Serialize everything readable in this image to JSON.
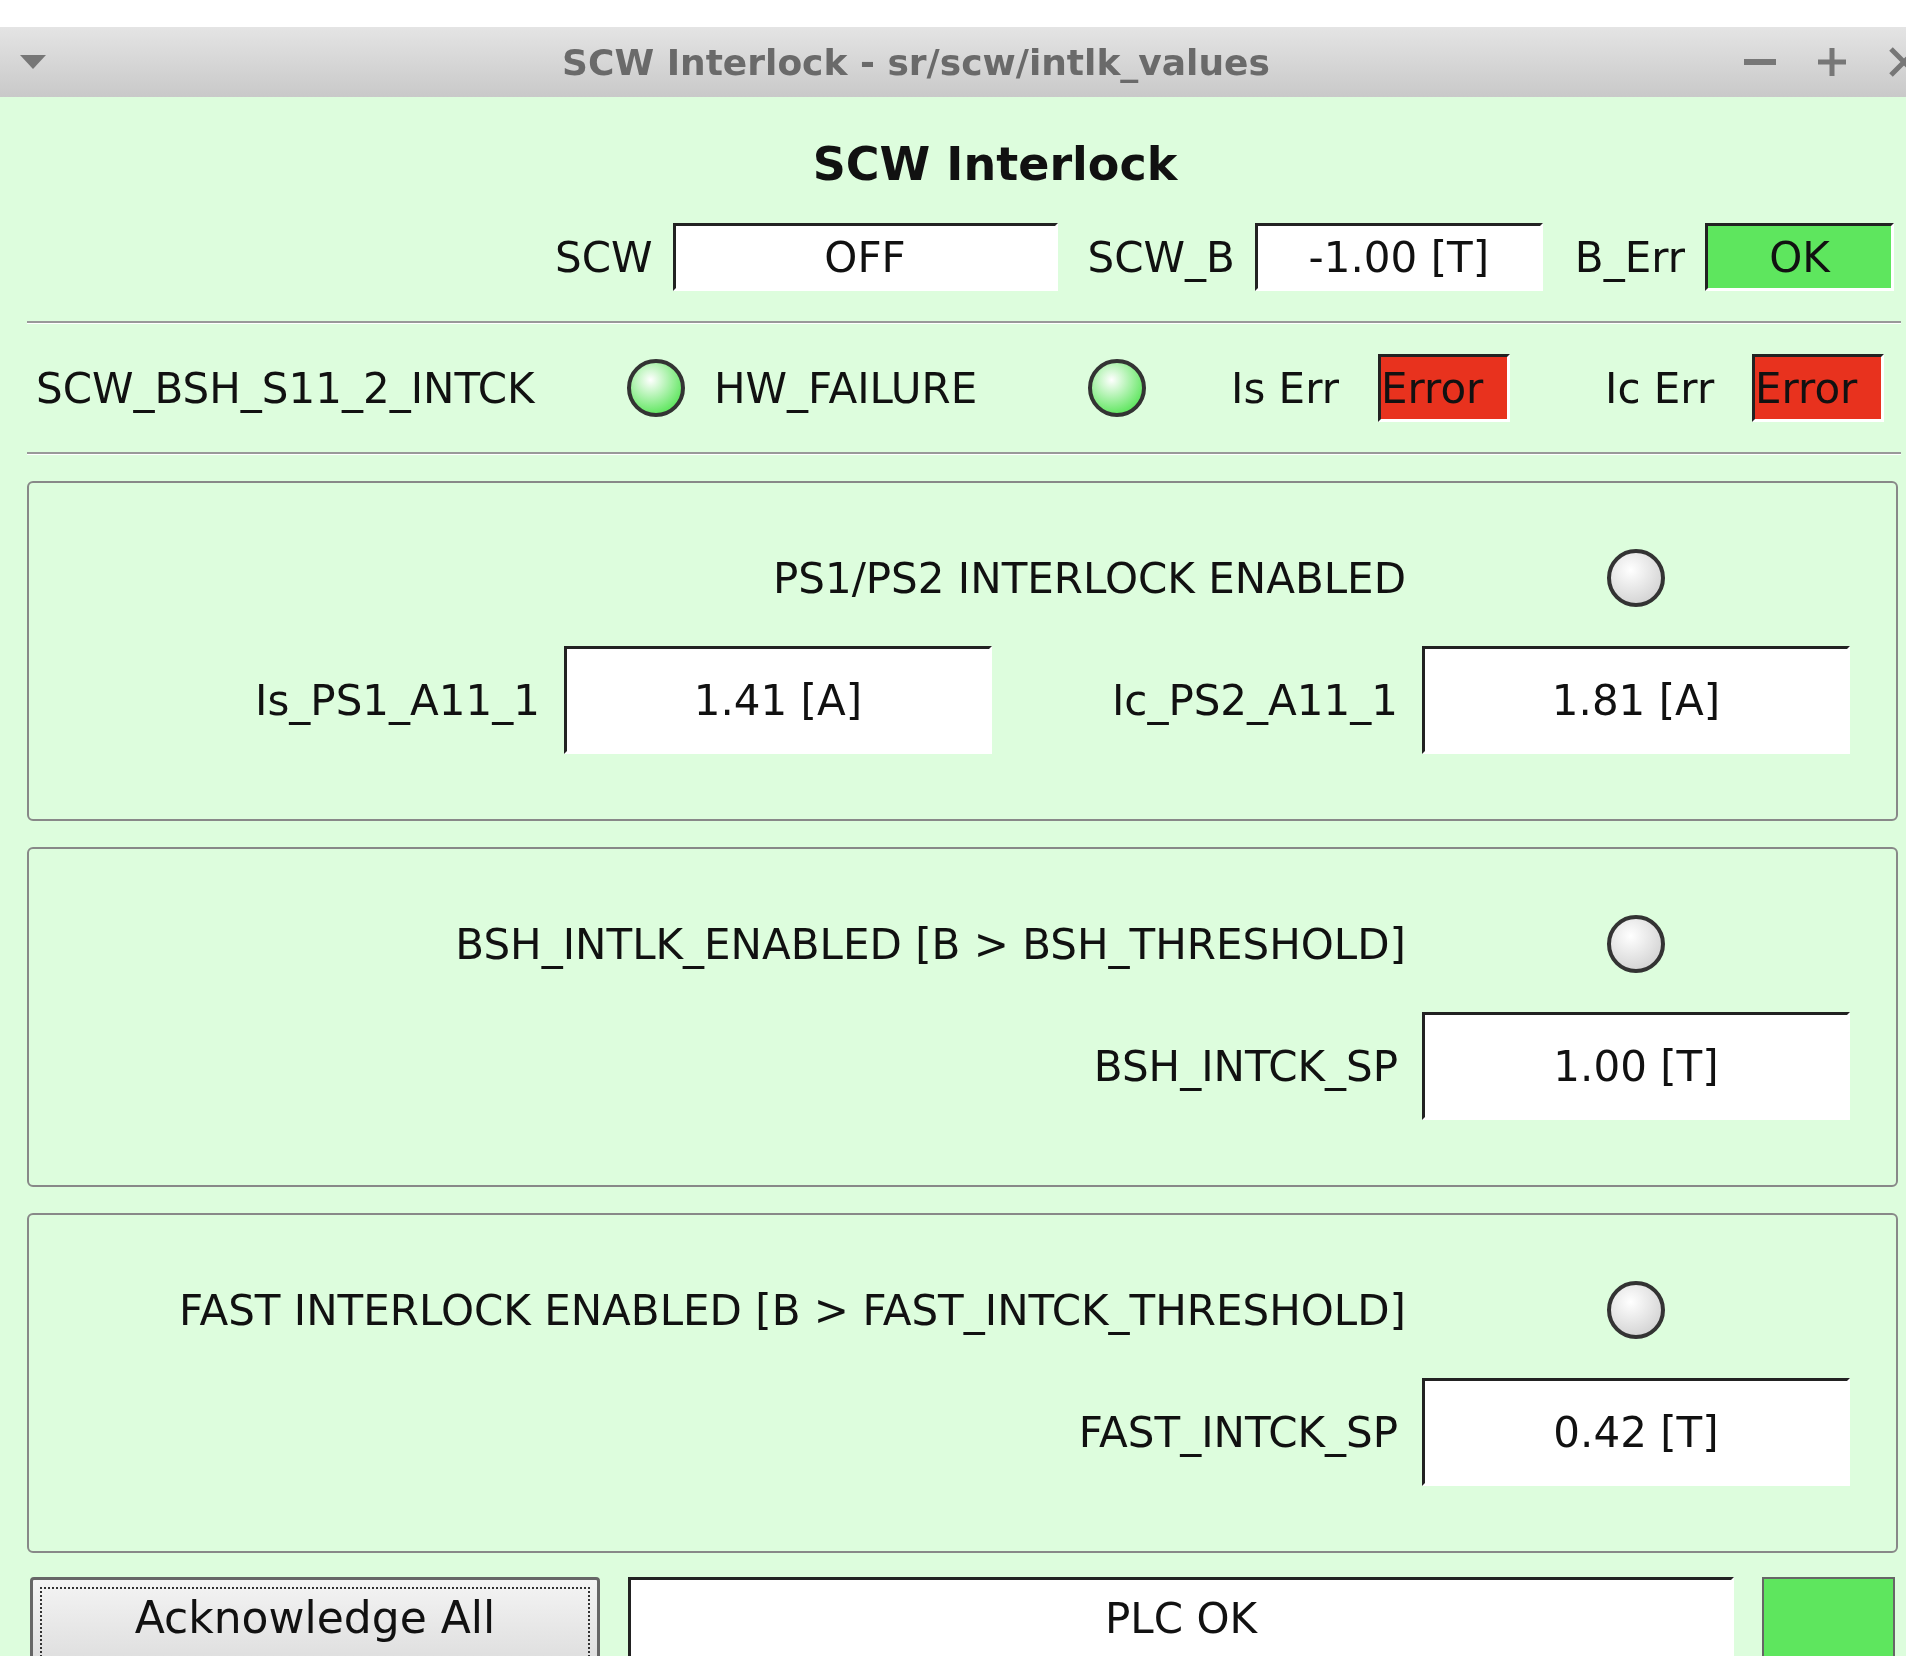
{
  "window": {
    "title": "SCW Interlock - sr/scw/intlk_values"
  },
  "heading": "SCW Interlock",
  "status_fields": [
    {
      "label": "SCW",
      "value": "OFF",
      "color": "#ffffff"
    },
    {
      "label": "SCW_B",
      "value": "-1.00 [T]",
      "color": "#ffffff"
    },
    {
      "label": "B_Err",
      "value": "OK",
      "color": "#5ee65e"
    }
  ],
  "indicators": [
    {
      "kind": "led",
      "label": "SCW_BSH_S11_2_INTCK",
      "on": true
    },
    {
      "kind": "led",
      "label": "HW_FAILURE",
      "on": true
    },
    {
      "kind": "field",
      "label": "Is Err",
      "value": "Error",
      "color": "#e8321e"
    },
    {
      "kind": "field",
      "label": "Ic Err",
      "value": "Error",
      "color": "#e8321e"
    }
  ],
  "panels": [
    {
      "title": "PS1/PS2 INTERLOCK ENABLED",
      "on": false,
      "readings": [
        {
          "label": "Is_PS1_A11_1",
          "value": "1.41 [A]"
        },
        {
          "label": "Ic_PS2_A11_1",
          "value": "1.81 [A]"
        }
      ]
    },
    {
      "title": "BSH_INTLK_ENABLED [B > BSH_THRESHOLD]",
      "on": false,
      "readings": [
        {
          "label": "BSH_INTCK_SP",
          "value": "1.00 [T]"
        }
      ]
    },
    {
      "title": "FAST INTERLOCK ENABLED [B > FAST_INTCK_THRESHOLD]",
      "on": false,
      "readings": [
        {
          "label": "FAST_INTCK_SP",
          "value": "0.42 [T]"
        }
      ]
    }
  ],
  "footer": {
    "button": "Acknowledge All",
    "status": "PLC OK",
    "plc_ok": true
  }
}
